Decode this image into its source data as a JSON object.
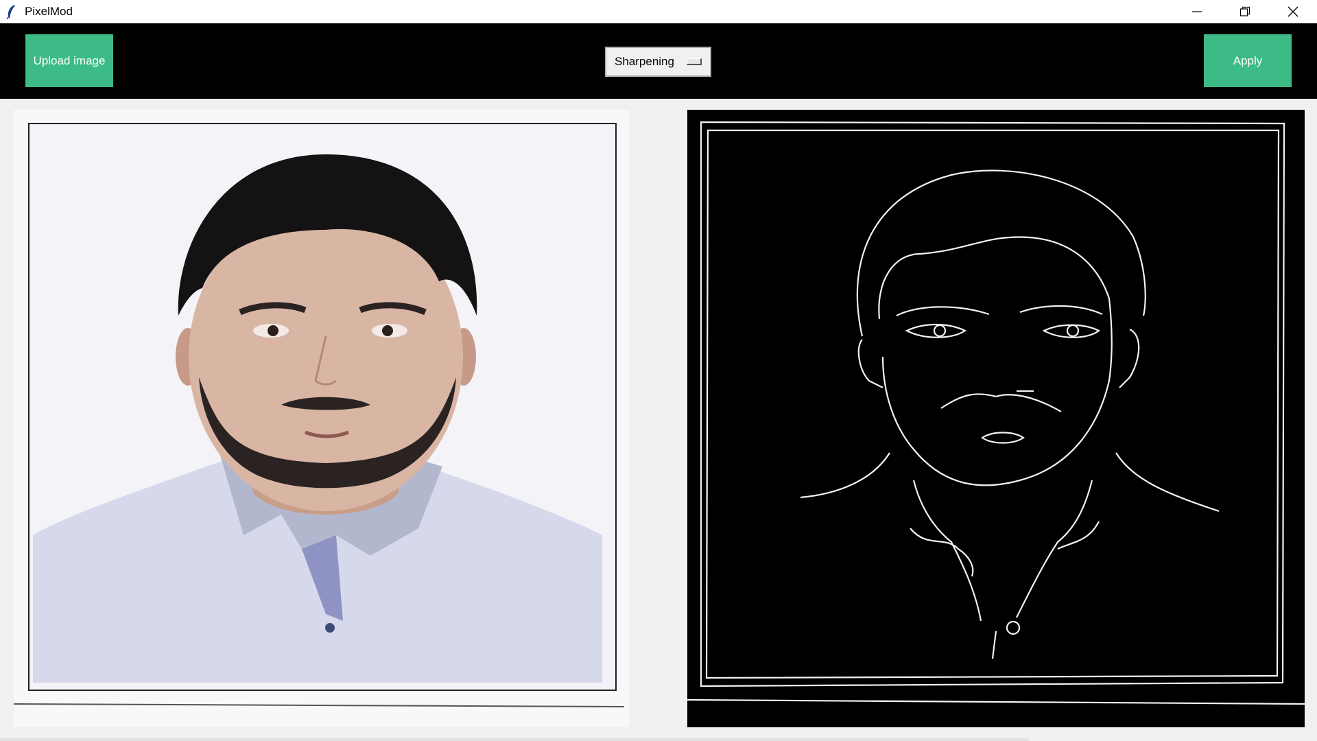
{
  "window": {
    "title": "PixelMod",
    "controls": [
      "minimize",
      "restore",
      "close"
    ]
  },
  "toolbar": {
    "upload_label": "Upload image",
    "filter_selected": "Sharpening",
    "apply_label": "Apply"
  },
  "images": {
    "original": "portrait photo",
    "processed": "edge-detected portrait"
  },
  "colors": {
    "accent": "#3dbb86",
    "toolbar_bg": "#000000",
    "window_bg": "#f0f0f0"
  }
}
